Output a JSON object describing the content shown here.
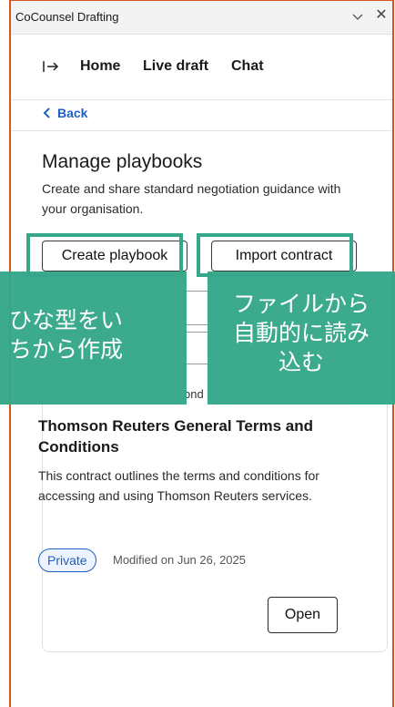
{
  "window": {
    "title": "CoCounsel Drafting"
  },
  "nav": {
    "home": "Home",
    "live_draft": "Live draft",
    "chat": "Chat"
  },
  "back": {
    "label": "Back"
  },
  "page": {
    "title": "Manage playbooks",
    "description": "Create and share standard negotiation guidance with your organisation."
  },
  "actions": {
    "create": "Create playbook",
    "import": "Import contract"
  },
  "partial_text": "ond",
  "annotations": {
    "left_line1": "ひな型をい",
    "left_line2": "ちから作成",
    "right_line1": "ファイルから",
    "right_line2": "自動的に読み",
    "right_line3": "込む"
  },
  "card": {
    "title": "Thomson Reuters General Terms and Conditions",
    "description": "This contract outlines the terms and conditions for accessing and using Thomson Reuters services.",
    "badge": "Private",
    "modified": "Modified on Jun 26, 2025",
    "open": "Open"
  },
  "colors": {
    "accent": "#1f5fc2",
    "highlight": "#35a88a",
    "frame": "#d9541e"
  }
}
